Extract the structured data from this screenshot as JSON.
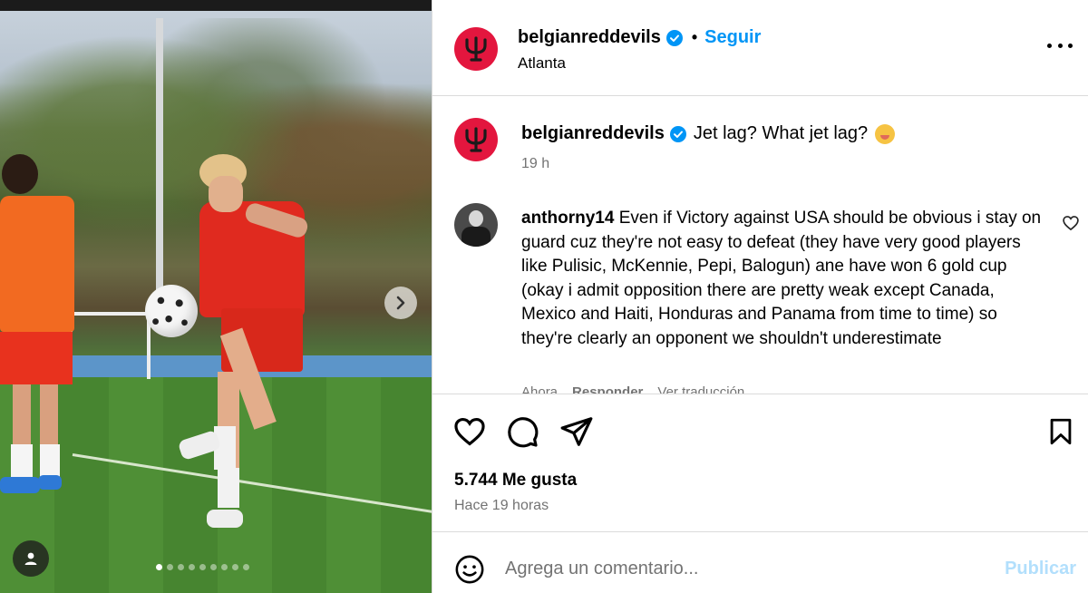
{
  "post": {
    "username": "belgianreddevils",
    "follow_label": "Seguir",
    "separator": "•",
    "location": "Atlanta",
    "caption": "Jet lag? What jet lag?",
    "caption_time": "19 h",
    "brand_color": "#e3163e",
    "verified_color": "#0095f6"
  },
  "comment": {
    "username": "anthorny14",
    "text": "Even if Victory against USA should be obvious i stay on guard cuz they're not easy to defeat (they have very good players like Pulisic, McKennie, Pepi, Balogun) ane have won 6 gold cup (okay i admit opposition there are pretty weak except Canada, Mexico and Haiti, Honduras and Panama from time to time) so they're clearly an opponent we shouldn't underestimate",
    "time": "Ahora",
    "reply_label": "Responder",
    "translate_label": "Ver traducción"
  },
  "stats": {
    "likes": "5.744 Me gusta",
    "posted_ago": "Hace 19 horas"
  },
  "composer": {
    "placeholder": "Agrega un comentario...",
    "publish_label": "Publicar"
  },
  "carousel": {
    "slide_count": 9,
    "active_slide": 1
  },
  "icons": [
    "trident-logo-icon",
    "verified-badge-icon",
    "more-options-icon",
    "heart-icon",
    "comment-icon",
    "share-icon",
    "bookmark-icon",
    "emoji-icon",
    "chevron-right-icon",
    "user-icon",
    "face-emoji-icon"
  ]
}
